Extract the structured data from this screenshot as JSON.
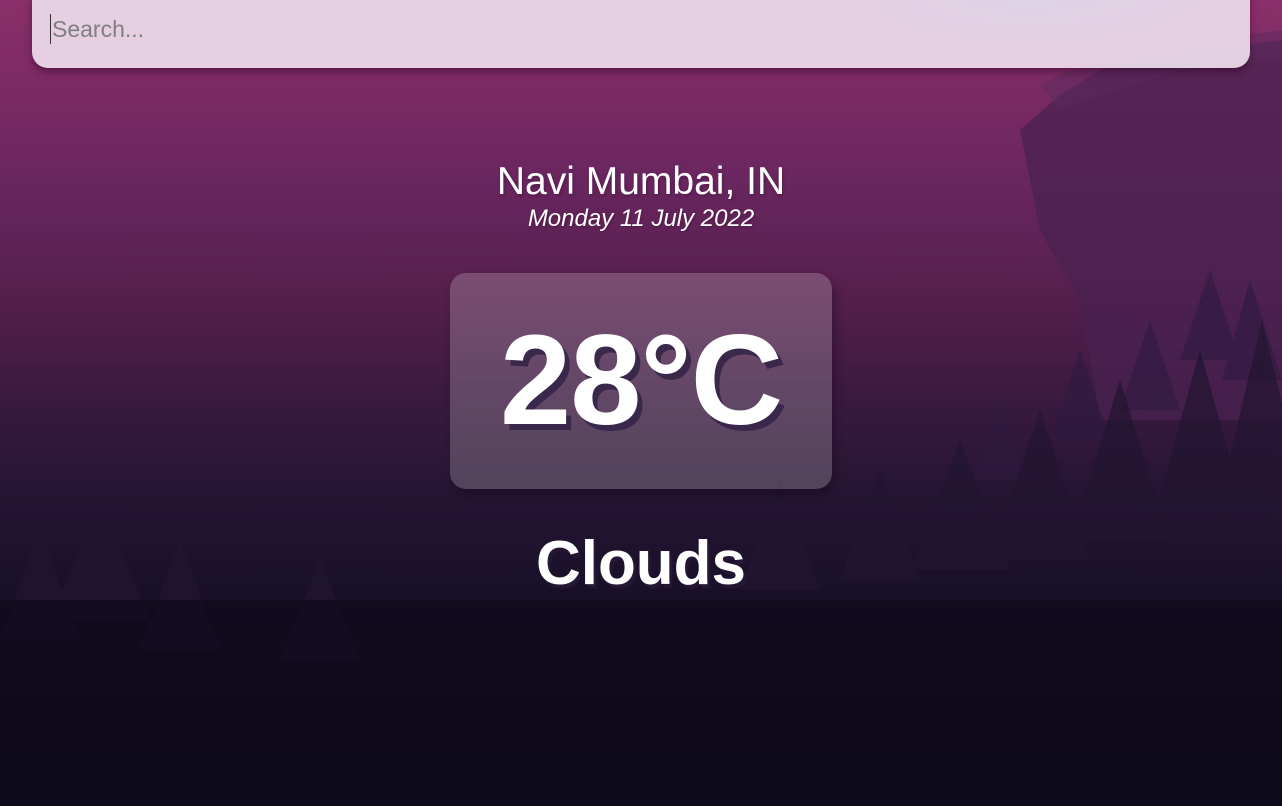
{
  "search": {
    "placeholder": "Search...",
    "value": ""
  },
  "weather": {
    "location": "Navi Mumbai, IN",
    "date": "Monday 11 July 2022",
    "temperature": "28°C",
    "condition": "Clouds"
  },
  "colors": {
    "sky_top": "#8a2f6a",
    "sky_bottom": "#0d0b1b",
    "text": "#ffffff",
    "search_bg": "#eeddec"
  }
}
